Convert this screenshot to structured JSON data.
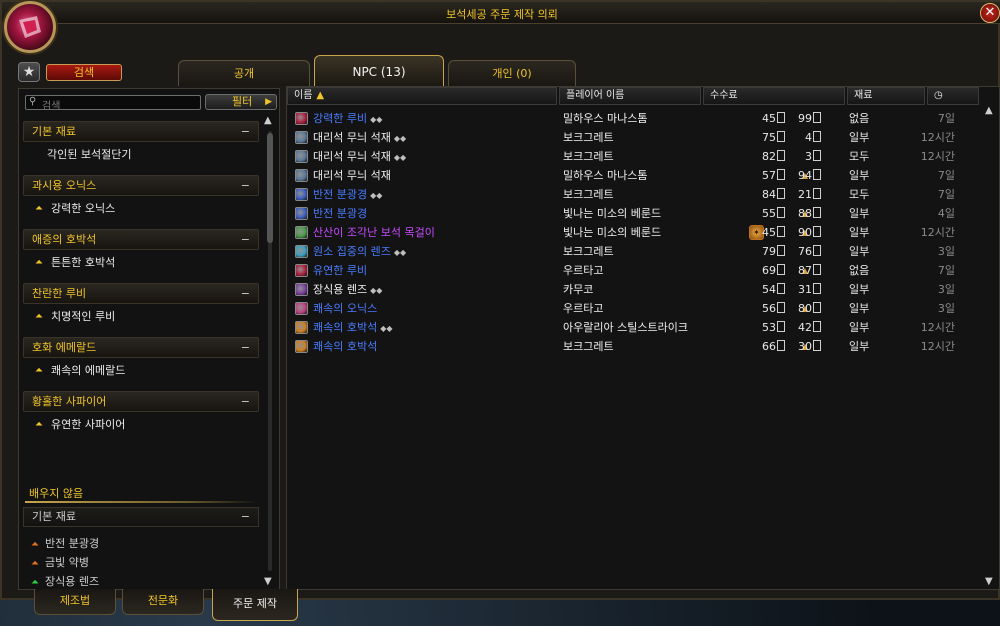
{
  "window": {
    "title": "보석세공 주문 제작 의뢰",
    "close_label": "✕"
  },
  "search_button": "검색",
  "tabs": [
    {
      "label": "공개"
    },
    {
      "label": "NPC (13)"
    },
    {
      "label": "개인 (0)"
    }
  ],
  "left": {
    "search_placeholder": "검색",
    "filter_label": "필터",
    "categories": [
      {
        "title": "기본 재료",
        "items": [
          {
            "label": "각인된 보석절단기",
            "chevron": false
          }
        ]
      },
      {
        "title": "과시용 오닉스",
        "items": [
          {
            "label": "강력한 오닉스",
            "chevron": true
          }
        ]
      },
      {
        "title": "애증의 호박석",
        "items": [
          {
            "label": "튼튼한 호박석",
            "chevron": true
          }
        ]
      },
      {
        "title": "찬란한 루비",
        "items": [
          {
            "label": "치명적인 루비",
            "chevron": true
          }
        ]
      },
      {
        "title": "호화 에메랄드",
        "items": [
          {
            "label": "쾌속의 에메랄드",
            "chevron": true
          }
        ]
      },
      {
        "title": "황홀한 사파이어",
        "items": [
          {
            "label": "유연한 사파이어",
            "chevron": true
          }
        ]
      }
    ],
    "unlearned_title": "배우지 않음",
    "unlearned_header": "기본 재료",
    "unlearned_items": [
      {
        "label": "반전 분광경",
        "icon": "orange-chevron-icon"
      },
      {
        "label": "금빛 약병",
        "icon": "orange-chevron-icon"
      },
      {
        "label": "장식용 렌즈",
        "icon": "green-chevron-icon"
      }
    ]
  },
  "table": {
    "columns": {
      "name": "이름",
      "sort_icon": "▲",
      "player": "플레이어 이름",
      "fee": "수수료",
      "materials": "재료",
      "time_icon": "clock-icon"
    },
    "rows": [
      {
        "name": "강력한 루비",
        "quality": "blue",
        "stars": "◆◆",
        "star_color": "silver",
        "icon_color": "#b02040",
        "player": "밀하우스 마나스톰",
        "gold": "45",
        "silver": "99",
        "materials": "없음",
        "time": "7일",
        "bag": false
      },
      {
        "name": "대리석 무늬 석재",
        "quality": "white",
        "stars": "◆◆",
        "star_color": "silver",
        "icon_color": "#5a7a9a",
        "player": "보크그레트",
        "gold": "75",
        "silver": "4",
        "materials": "일부",
        "time": "12시간",
        "bag": false
      },
      {
        "name": "대리석 무늬 석재",
        "quality": "white",
        "stars": "◆◆",
        "star_color": "silver",
        "icon_color": "#5a7a9a",
        "player": "보크그레트",
        "gold": "82",
        "silver": "3",
        "materials": "모두",
        "time": "12시간",
        "bag": false
      },
      {
        "name": "대리석 무늬 석재",
        "quality": "white",
        "stars": "▲",
        "star_color": "gold",
        "icon_color": "#5a7a9a",
        "player": "밀하우스 마나스톰",
        "gold": "57",
        "silver": "94",
        "materials": "일부",
        "time": "7일",
        "bag": false
      },
      {
        "name": "반전 분광경",
        "quality": "blue",
        "stars": "◆◆",
        "star_color": "silver",
        "icon_color": "#4060c0",
        "player": "보크그레트",
        "gold": "84",
        "silver": "21",
        "materials": "모두",
        "time": "7일",
        "bag": false
      },
      {
        "name": "반전 분광경",
        "quality": "blue",
        "stars": "▲",
        "star_color": "gold",
        "icon_color": "#4060c0",
        "player": "빛나는 미소의 베룬드",
        "gold": "55",
        "silver": "88",
        "materials": "일부",
        "time": "4일",
        "bag": false
      },
      {
        "name": "산산이 조각난 보석 목걸이",
        "quality": "purple",
        "stars": "▲",
        "star_color": "gold",
        "icon_color": "#4a9a4a",
        "player": "빛나는 미소의 베룬드",
        "gold": "45",
        "silver": "90",
        "materials": "일부",
        "time": "12시간",
        "bag": true
      },
      {
        "name": "원소 집중의 렌즈",
        "quality": "blue",
        "stars": "◆◆",
        "star_color": "silver",
        "icon_color": "#3aa0c0",
        "player": "보크그레트",
        "gold": "79",
        "silver": "76",
        "materials": "일부",
        "time": "3일",
        "bag": false
      },
      {
        "name": "유연한 루비",
        "quality": "blue",
        "stars": "▲",
        "star_color": "gold",
        "icon_color": "#b02040",
        "player": "우르타고",
        "gold": "69",
        "silver": "87",
        "materials": "없음",
        "time": "7일",
        "bag": false
      },
      {
        "name": "장식용 렌즈",
        "quality": "white",
        "stars": "◆◆",
        "star_color": "silver",
        "icon_color": "#7a40a0",
        "player": "카무코",
        "gold": "54",
        "silver": "31",
        "materials": "일부",
        "time": "3일",
        "bag": false
      },
      {
        "name": "쾌속의 오닉스",
        "quality": "blue",
        "stars": "▲",
        "star_color": "gold",
        "icon_color": "#c04080",
        "player": "우르타고",
        "gold": "56",
        "silver": "80",
        "materials": "일부",
        "time": "3일",
        "bag": false
      },
      {
        "name": "쾌속의 호박석",
        "quality": "blue",
        "stars": "◆◆",
        "star_color": "silver",
        "icon_color": "#d08020",
        "player": "아우랄리아 스틸스트라이크",
        "gold": "53",
        "silver": "42",
        "materials": "일부",
        "time": "12시간",
        "bag": false
      },
      {
        "name": "쾌속의 호박석",
        "quality": "blue",
        "stars": "▲",
        "star_color": "gold",
        "icon_color": "#d08020",
        "player": "보크그레트",
        "gold": "66",
        "silver": "30",
        "materials": "일부",
        "time": "12시간",
        "bag": false
      }
    ]
  },
  "bottom_tabs": [
    {
      "label": "제조법"
    },
    {
      "label": "전문화"
    },
    {
      "label": "주문 제작"
    }
  ],
  "colors": {
    "accent_gold": "#f0c528",
    "quality_blue": "#4a7cff",
    "quality_purple": "#c64cff",
    "close_red": "#c0261b"
  }
}
